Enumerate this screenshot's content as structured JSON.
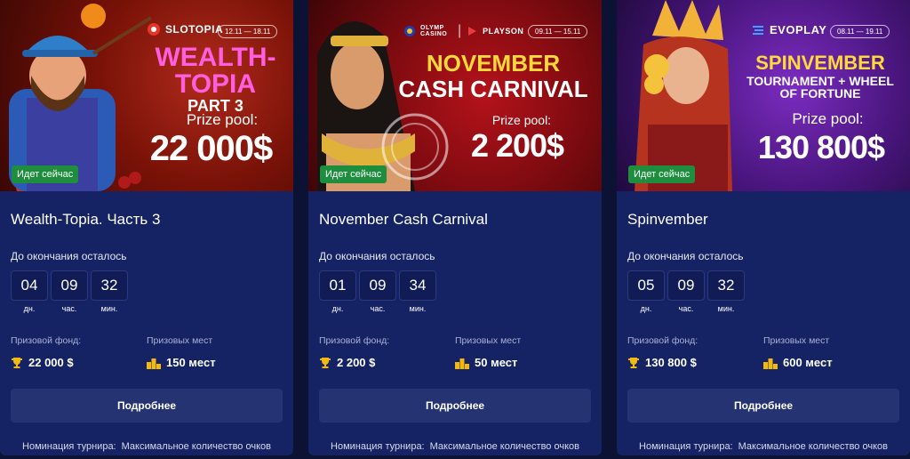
{
  "cards": [
    {
      "provider": "SLOTOPIA",
      "dates": "12.11 — 18.11",
      "promo_title": "WEALTH-",
      "promo_title2": "TOPIA",
      "promo_sub": "PART 3",
      "prize_label": "Prize pool:",
      "prize_value": "22 000$",
      "live_badge": "Идет сейчас",
      "title": "Wealth-Topia. Часть 3",
      "remaining_label": "До окончания осталось",
      "timer": [
        {
          "value": "04",
          "unit": "дн."
        },
        {
          "value": "09",
          "unit": "час."
        },
        {
          "value": "32",
          "unit": "мин."
        }
      ],
      "prize_fund_label": "Призовой фонд:",
      "prize_fund_value": "22 000 $",
      "places_label": "Призовых мест",
      "places_value": "150 мест",
      "details_button": "Подробнее",
      "nomination_label": "Номинация турнира:",
      "nomination_value": "Максимальное количество очков"
    },
    {
      "provider": "OLYMP CASINO",
      "provider2": "PLAYSON",
      "dates": "09.11 — 15.11",
      "promo_title": "NOVEMBER",
      "promo_title2": "CASH CARNIVAL",
      "prize_label": "Prize pool:",
      "prize_value": "2 200$",
      "stamp": "LOCAL · OLYMP CASINO · TOURNAMENT",
      "live_badge": "Идет сейчас",
      "title": "November Cash Carnival",
      "remaining_label": "До окончания осталось",
      "timer": [
        {
          "value": "01",
          "unit": "дн."
        },
        {
          "value": "09",
          "unit": "час."
        },
        {
          "value": "34",
          "unit": "мин."
        }
      ],
      "prize_fund_label": "Призовой фонд:",
      "prize_fund_value": "2 200 $",
      "places_label": "Призовых мест",
      "places_value": "50 мест",
      "details_button": "Подробнее",
      "nomination_label": "Номинация турнира:",
      "nomination_value": "Максимальное количество очков"
    },
    {
      "provider": "EVOPLAY",
      "dates": "08.11 — 19.11",
      "promo_title": "SPINVEMBER",
      "promo_title2": "TOURNAMENT + WHEEL",
      "promo_title3": "OF FORTUNE",
      "prize_label": "Prize pool:",
      "prize_value": "130 800$",
      "live_badge": "Идет сейчас",
      "title": "Spinvember",
      "remaining_label": "До окончания осталось",
      "timer": [
        {
          "value": "05",
          "unit": "дн."
        },
        {
          "value": "09",
          "unit": "час."
        },
        {
          "value": "32",
          "unit": "мин."
        }
      ],
      "prize_fund_label": "Призовой фонд:",
      "prize_fund_value": "130 800 $",
      "places_label": "Призовых мест",
      "places_value": "600 мест",
      "details_button": "Подробнее",
      "nomination_label": "Номинация турнира:",
      "nomination_value": "Максимальное количество очков"
    }
  ],
  "colors": {
    "page_bg": "#0b1233",
    "card_bg": "#152263",
    "live_badge": "#1e8e3e",
    "button_bg": "#263373",
    "trophy": "#f2b90f",
    "promo_pink": "#ff5ee0",
    "promo_yellow": "#ffd93a"
  }
}
